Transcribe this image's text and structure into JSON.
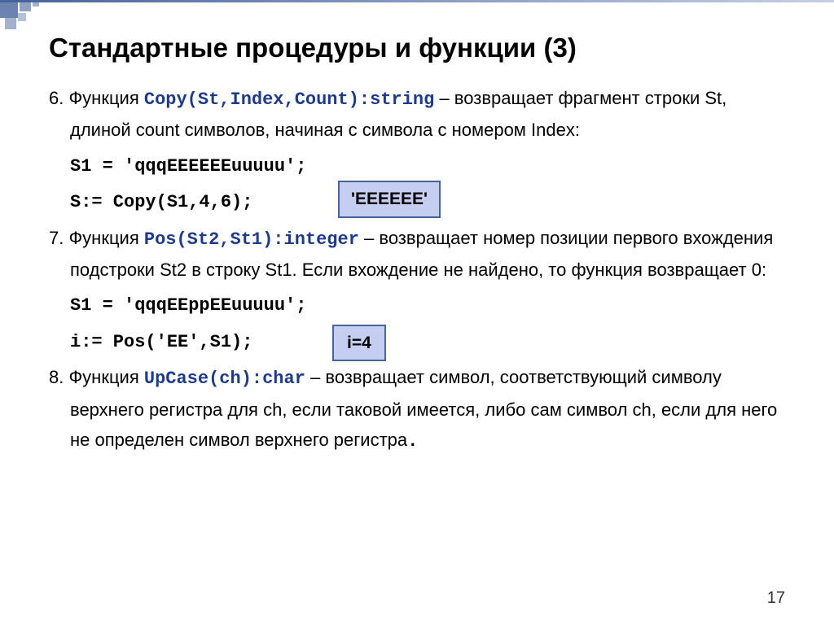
{
  "title": "Стандартные процедуры и функции (3)",
  "item6": {
    "num": "6. Функция ",
    "code": "Copy(St,Index,Count):string",
    "desc": " – возвращает фрагмент строки St, длиной count символов, начиная с символа с номером Index:",
    "line1": "S1 = 'qqqEEEEEEuuuuu';",
    "line2": "S:= Copy(S1,4,6);",
    "result": "'EEEEEE'"
  },
  "item7": {
    "num": "7. Функция ",
    "code": "Pos(St2,St1):integer",
    "desc": " – возвращает номер позиции первого вхождения подстроки St2 в строку St1. Если вхождение не найдено, то функция возвращает 0:",
    "line1": "S1 = 'qqqEEppEEuuuuu';",
    "line2": "i:= Pos('EE',S1);",
    "result": "i=4"
  },
  "item8": {
    "num": "8. Функция ",
    "code": "UpCase(ch):char",
    "desc": " – возвращает символ, соответствующий символу верхнего регистра для ch, если таковой имеется, либо сам символ ch, если для него не определен символ верхнего регистра",
    "period": "."
  },
  "pageNumber": "17"
}
